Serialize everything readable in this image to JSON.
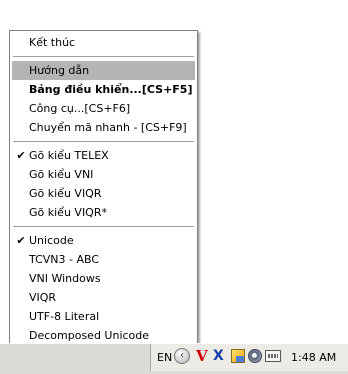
{
  "menu": {
    "groups": [
      {
        "items": [
          {
            "label": "Kết thúc"
          }
        ]
      },
      {
        "items": [
          {
            "label": "Hướng dẫn",
            "highlighted": true
          },
          {
            "label": "Bảng điều khiển...[CS+F5]",
            "bold": true
          },
          {
            "label": "Công cụ...[CS+F6]"
          },
          {
            "label": "Chuyển mã nhanh - [CS+F9]"
          }
        ]
      },
      {
        "items": [
          {
            "label": "Gõ kiểu TELEX",
            "checked": true
          },
          {
            "label": "Gõ kiểu VNI"
          },
          {
            "label": "Gõ kiểu VIQR"
          },
          {
            "label": "Gõ kiểu VIQR*"
          }
        ]
      },
      {
        "items": [
          {
            "label": "Unicode",
            "checked": true
          },
          {
            "label": "TCVN3 - ABC"
          },
          {
            "label": "VNI Windows"
          },
          {
            "label": "VIQR"
          },
          {
            "label": "UTF-8 Literal"
          },
          {
            "label": "Decomposed Unicode"
          }
        ]
      }
    ],
    "check_glyph": "✔"
  },
  "tray": {
    "language": "EN",
    "vietkey_letter": "V",
    "x_letter": "X",
    "clock": "1:48 AM"
  }
}
